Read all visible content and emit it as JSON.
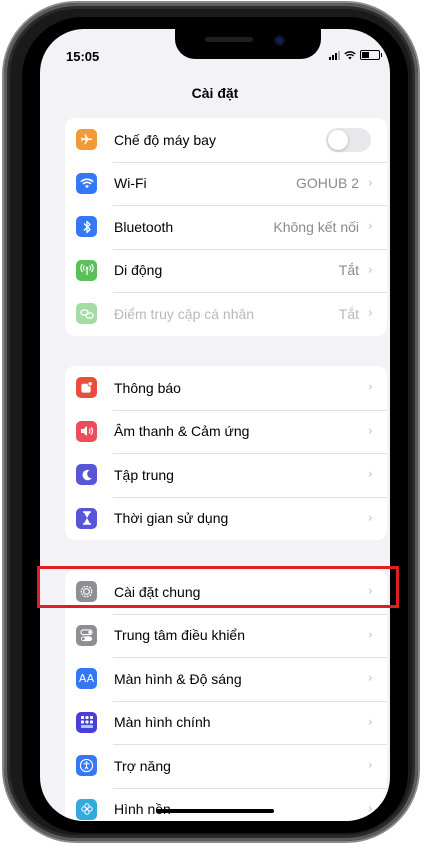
{
  "status_bar": {
    "time": "15:05"
  },
  "nav": {
    "title": "Cài đặt"
  },
  "groups": [
    {
      "rows": [
        {
          "label": "Chế độ máy bay",
          "icon": "airplane-icon",
          "icon_color": "#f19a37",
          "toggle": false
        },
        {
          "label": "Wi-Fi",
          "value": "GOHUB 2",
          "icon": "wifi-icon",
          "icon_color": "#3478f6"
        },
        {
          "label": "Bluetooth",
          "value": "Không kết nối",
          "icon": "bluetooth-icon",
          "icon_color": "#3478f6"
        },
        {
          "label": "Di động",
          "value": "Tắt",
          "icon": "antenna-icon",
          "icon_color": "#5ac15a"
        },
        {
          "label": "Điểm truy cập cá nhân",
          "value": "Tắt",
          "icon": "hotspot-icon",
          "icon_color": "#5ac15a",
          "disabled": true
        }
      ]
    },
    {
      "rows": [
        {
          "label": "Thông báo",
          "icon": "notification-icon",
          "icon_color": "#eb4d3d"
        },
        {
          "label": "Âm thanh & Cảm ứng",
          "icon": "speaker-icon",
          "icon_color": "#eb4d5d"
        },
        {
          "label": "Tập trung",
          "icon": "moon-icon",
          "icon_color": "#5856d6"
        },
        {
          "label": "Thời gian sử dụng",
          "icon": "hourglass-icon",
          "icon_color": "#5856d6"
        }
      ]
    },
    {
      "rows": [
        {
          "label": "Cài đặt chung",
          "icon": "gear-icon",
          "icon_color": "#8e8e93",
          "highlighted": true
        },
        {
          "label": "Trung tâm điều khiển",
          "icon": "control-center-icon",
          "icon_color": "#8e8e93"
        },
        {
          "label": "Màn hình & Độ sáng",
          "icon": "text-size-icon",
          "icon_color": "#3478f6",
          "icon_text": "AA"
        },
        {
          "label": "Màn hình chính",
          "icon": "home-screen-icon",
          "icon_color": "#4a3ed8"
        },
        {
          "label": "Trợ năng",
          "icon": "accessibility-icon",
          "icon_color": "#3478f6"
        },
        {
          "label": "Hình nền",
          "icon": "wallpaper-icon",
          "icon_color": "#34aadc"
        }
      ]
    }
  ],
  "chevron": "›",
  "colors": {
    "highlight": "#e02020",
    "background": "#f2f2f7"
  }
}
